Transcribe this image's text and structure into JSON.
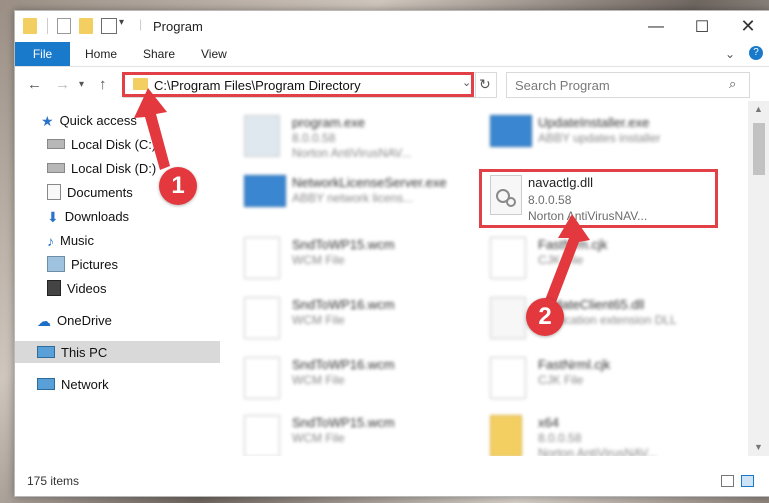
{
  "window": {
    "title": "Program"
  },
  "ribbon": {
    "file": "File",
    "tabs": [
      "Home",
      "Share",
      "View"
    ]
  },
  "address": {
    "path": "C:\\Program Files\\Program Directory"
  },
  "search": {
    "placeholder": "Search Program"
  },
  "sidebar": {
    "items": [
      {
        "label": "Quick access",
        "pinned": false
      },
      {
        "label": "Local Disk (C:)",
        "pinned": true
      },
      {
        "label": "Local Disk (D:)",
        "pinned": true
      },
      {
        "label": "Documents",
        "pinned": true
      },
      {
        "label": "Downloads",
        "pinned": true
      },
      {
        "label": "Music",
        "pinned": true
      },
      {
        "label": "Pictures",
        "pinned": true
      },
      {
        "label": "Videos",
        "pinned": true
      },
      {
        "label": "OneDrive",
        "pinned": false
      },
      {
        "label": "This PC",
        "pinned": false
      },
      {
        "label": "Network",
        "pinned": false
      }
    ]
  },
  "files": [
    {
      "name": "program.exe",
      "line2": "8.0.0.58",
      "line3": "Norton AntiVirusNAV..."
    },
    {
      "name": "UpdateInstaller.exe",
      "line2": "ABBY updates installer",
      "line3": ""
    },
    {
      "name": "NetworkLicenseServer.exe",
      "line2": "ABBY network licens...",
      "line3": ""
    },
    {
      "name": "navactlg.dll",
      "line2": "8.0.0.58",
      "line3": "Norton AntiVirusNAV..."
    },
    {
      "name": "SndToWP15.wcm",
      "line2": "WCM File",
      "line3": ""
    },
    {
      "name": "FastNrm.cjk",
      "line2": "CJK File",
      "line3": ""
    },
    {
      "name": "SndToWP16.wcm",
      "line2": "WCM File",
      "line3": ""
    },
    {
      "name": "UpdateClient65.dll",
      "line2": "Application extension DLL",
      "line3": ""
    },
    {
      "name": "SndToWP16.wcm",
      "line2": "WCM File",
      "line3": ""
    },
    {
      "name": "FastNrml.cjk",
      "line2": "CJK File",
      "line3": ""
    },
    {
      "name": "SndToWP15.wcm",
      "line2": "WCM File",
      "line3": ""
    },
    {
      "name": "x64",
      "line2": "8.0.0.58",
      "line3": "Norton AntiVirusNAV..."
    }
  ],
  "status": {
    "items": "175 items"
  },
  "annotations": {
    "step1": "1",
    "step2": "2"
  },
  "colors": {
    "accent": "#1979ca",
    "highlight": "#e04046"
  }
}
